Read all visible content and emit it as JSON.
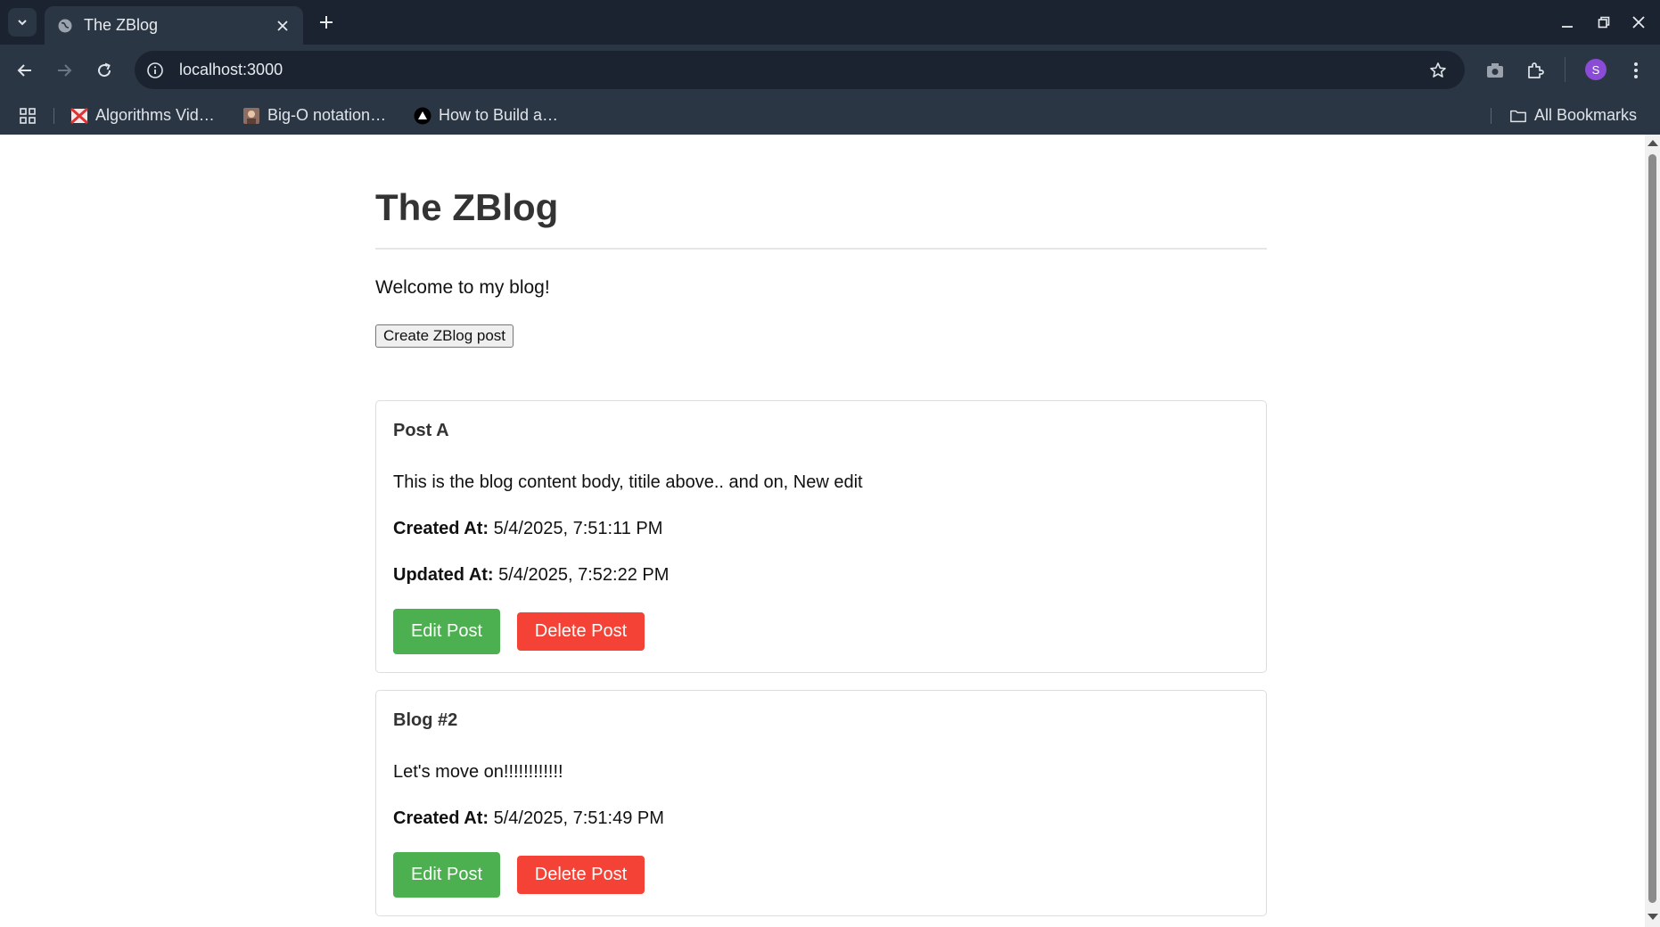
{
  "browser": {
    "tab_title": "The ZBlog",
    "url": "localhost:3000",
    "profile_initial": "S",
    "bookmarks": [
      {
        "label": "Algorithms Vid…",
        "icon": "crossed-flag-icon"
      },
      {
        "label": "Big-O notation…",
        "icon": "portrait-icon"
      },
      {
        "label": "How to Build a…",
        "icon": "triangle-logo-icon"
      }
    ],
    "all_bookmarks_label": "All Bookmarks"
  },
  "page": {
    "title": "The ZBlog",
    "welcome": "Welcome to my blog!",
    "create_button": "Create ZBlog post",
    "colors": {
      "edit": "#4caf50",
      "delete": "#f44336"
    },
    "posts": [
      {
        "title": "Post A",
        "body": "This is the blog content body, titile above.. and on, New edit",
        "created_label": "Created At:",
        "created_value": "5/4/2025, 7:51:11 PM",
        "updated_label": "Updated At:",
        "updated_value": "5/4/2025, 7:52:22 PM",
        "edit_label": "Edit Post",
        "delete_label": "Delete Post"
      },
      {
        "title": "Blog #2",
        "body": "Let's move on!!!!!!!!!!!!",
        "created_label": "Created At:",
        "created_value": "5/4/2025, 7:51:49 PM",
        "edit_label": "Edit Post",
        "delete_label": "Delete Post"
      }
    ]
  }
}
